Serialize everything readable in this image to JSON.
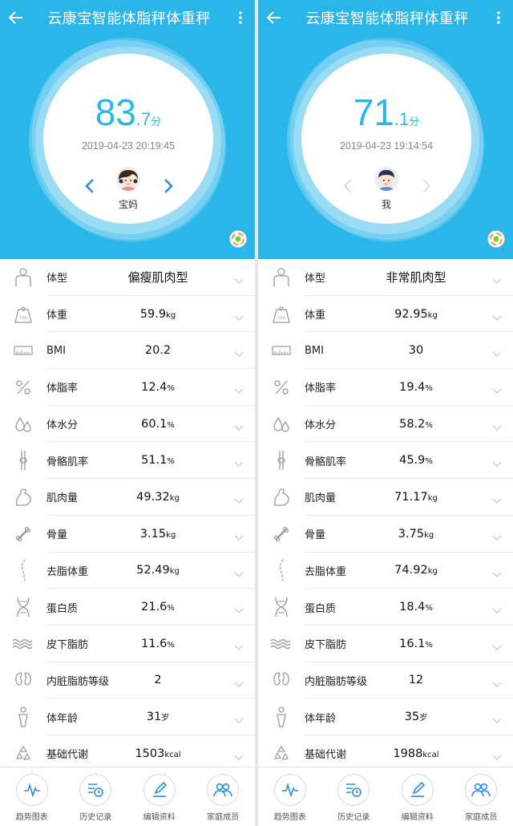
{
  "panels": [
    {
      "title": "云康宝智能体脂秤体重秤",
      "score_int": "83",
      "score_dec": ".7",
      "score_unit": "分",
      "datetime": "2019-04-23 20:19:45",
      "user_name": "宝妈",
      "rows": [
        {
          "icon": "body-shape-icon",
          "name": "体型",
          "value": "偏瘦肌肉型",
          "unit": ""
        },
        {
          "icon": "weight-scale-icon",
          "name": "体重",
          "value": "59.9",
          "unit": "kg"
        },
        {
          "icon": "bmi-ruler-icon",
          "name": "BMI",
          "value": "20.2",
          "unit": ""
        },
        {
          "icon": "percent-icon",
          "name": "体脂率",
          "value": "12.4",
          "unit": "%"
        },
        {
          "icon": "water-drop-icon",
          "name": "体水分",
          "value": "60.1",
          "unit": "%"
        },
        {
          "icon": "skeletal-muscle-icon",
          "name": "骨骼肌率",
          "value": "51.1",
          "unit": "%"
        },
        {
          "icon": "arm-muscle-icon",
          "name": "肌肉量",
          "value": "49.32",
          "unit": "kg"
        },
        {
          "icon": "bone-icon",
          "name": "骨量",
          "value": "3.15",
          "unit": "kg"
        },
        {
          "icon": "spine-icon",
          "name": "去脂体重",
          "value": "52.49",
          "unit": "kg"
        },
        {
          "icon": "dna-icon",
          "name": "蛋白质",
          "value": "21.6",
          "unit": "%"
        },
        {
          "icon": "subcutaneous-fat-icon",
          "name": "皮下脂肪",
          "value": "11.6",
          "unit": "%"
        },
        {
          "icon": "organ-icon",
          "name": "内脏脂肪等级",
          "value": "2",
          "unit": ""
        },
        {
          "icon": "body-age-icon",
          "name": "体年龄",
          "value": "31",
          "unit": "岁"
        },
        {
          "icon": "metabolism-icon",
          "name": "基础代谢",
          "value": "1503",
          "unit": "kcal"
        }
      ]
    },
    {
      "title": "云康宝智能体脂秤体重秤",
      "score_int": "71",
      "score_dec": ".1",
      "score_unit": "分",
      "datetime": "2019-04-23 19:14:54",
      "user_name": "我",
      "rows": [
        {
          "icon": "body-shape-icon",
          "name": "体型",
          "value": "非常肌肉型",
          "unit": ""
        },
        {
          "icon": "weight-scale-icon",
          "name": "体重",
          "value": "92.95",
          "unit": "kg"
        },
        {
          "icon": "bmi-ruler-icon",
          "name": "BMI",
          "value": "30",
          "unit": ""
        },
        {
          "icon": "percent-icon",
          "name": "体脂率",
          "value": "19.4",
          "unit": "%"
        },
        {
          "icon": "water-drop-icon",
          "name": "体水分",
          "value": "58.2",
          "unit": "%"
        },
        {
          "icon": "skeletal-muscle-icon",
          "name": "骨骼肌率",
          "value": "45.9",
          "unit": "%"
        },
        {
          "icon": "arm-muscle-icon",
          "name": "肌肉量",
          "value": "71.17",
          "unit": "kg"
        },
        {
          "icon": "bone-icon",
          "name": "骨量",
          "value": "3.75",
          "unit": "kg"
        },
        {
          "icon": "spine-icon",
          "name": "去脂体重",
          "value": "74.92",
          "unit": "kg"
        },
        {
          "icon": "dna-icon",
          "name": "蛋白质",
          "value": "18.4",
          "unit": "%"
        },
        {
          "icon": "subcutaneous-fat-icon",
          "name": "皮下脂肪",
          "value": "16.1",
          "unit": "%"
        },
        {
          "icon": "organ-icon",
          "name": "内脏脂肪等级",
          "value": "12",
          "unit": ""
        },
        {
          "icon": "body-age-icon",
          "name": "体年龄",
          "value": "35",
          "unit": "岁"
        },
        {
          "icon": "metabolism-icon",
          "name": "基础代谢",
          "value": "1988",
          "unit": "kcal"
        }
      ]
    }
  ],
  "tabs": [
    {
      "icon": "trend-chart-icon",
      "label": "趋势图表"
    },
    {
      "icon": "history-record-icon",
      "label": "历史记录"
    },
    {
      "icon": "edit-profile-icon",
      "label": "编辑资料"
    },
    {
      "icon": "family-members-icon",
      "label": "家庭成员"
    }
  ],
  "colors": {
    "header": "#2bb6ea",
    "accent": "#2b8de0",
    "score": "#2bb6ea"
  }
}
